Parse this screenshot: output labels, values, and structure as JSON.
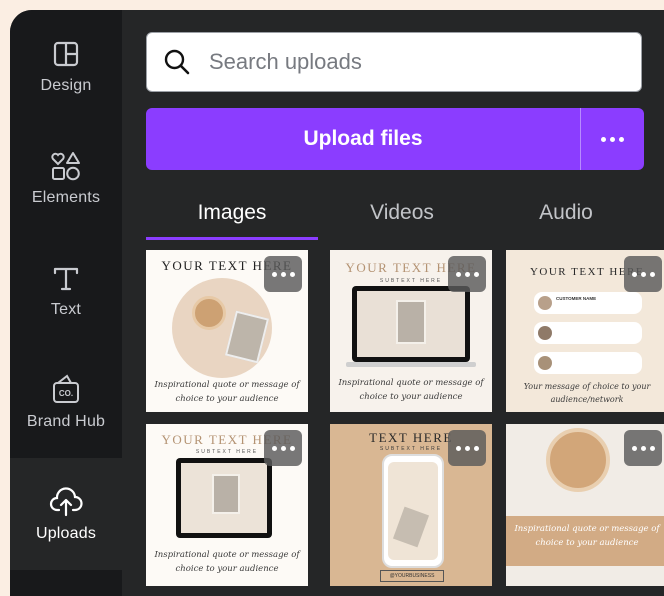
{
  "sidebar": {
    "items": [
      {
        "label": "Design",
        "icon": "layout-icon",
        "active": false
      },
      {
        "label": "Elements",
        "icon": "shapes-icon",
        "active": false
      },
      {
        "label": "Text",
        "icon": "text-icon",
        "active": false
      },
      {
        "label": "Brand Hub",
        "icon": "brand-hub-icon",
        "active": false
      },
      {
        "label": "Uploads",
        "icon": "cloud-upload-icon",
        "active": true
      }
    ]
  },
  "search": {
    "placeholder": "Search uploads"
  },
  "upload": {
    "label": "Upload files"
  },
  "tabs": [
    {
      "label": "Images",
      "active": true
    },
    {
      "label": "Videos",
      "active": false
    },
    {
      "label": "Audio",
      "active": false
    }
  ],
  "thumbnails": [
    {
      "heading": "YOUR TEXT HERE",
      "quote": "Inspirational quote or message of choice to your audience"
    },
    {
      "heading": "YOUR TEXT HERE",
      "subheading": "SUBTEXT HERE",
      "quote": "Inspirational quote or message of choice to your audience"
    },
    {
      "heading": "YOUR TEXT HERE",
      "review_name": "CUSTOMER NAME",
      "quote": "Your message of choice to your audience/network"
    },
    {
      "heading": "YOUR TEXT HERE",
      "subheading": "SUBTEXT HERE",
      "quote": "Inspirational quote or message of choice to your audience"
    },
    {
      "heading": "TEXT HERE",
      "subheading": "SUBTEXT HERE",
      "footer": "@YOURBUSINESS"
    },
    {
      "quote": "Inspirational quote or message of choice to your audience"
    }
  ],
  "colors": {
    "accent": "#8b3dff",
    "panel": "#252627",
    "rail": "#18191b",
    "page": "#fbeee3"
  }
}
